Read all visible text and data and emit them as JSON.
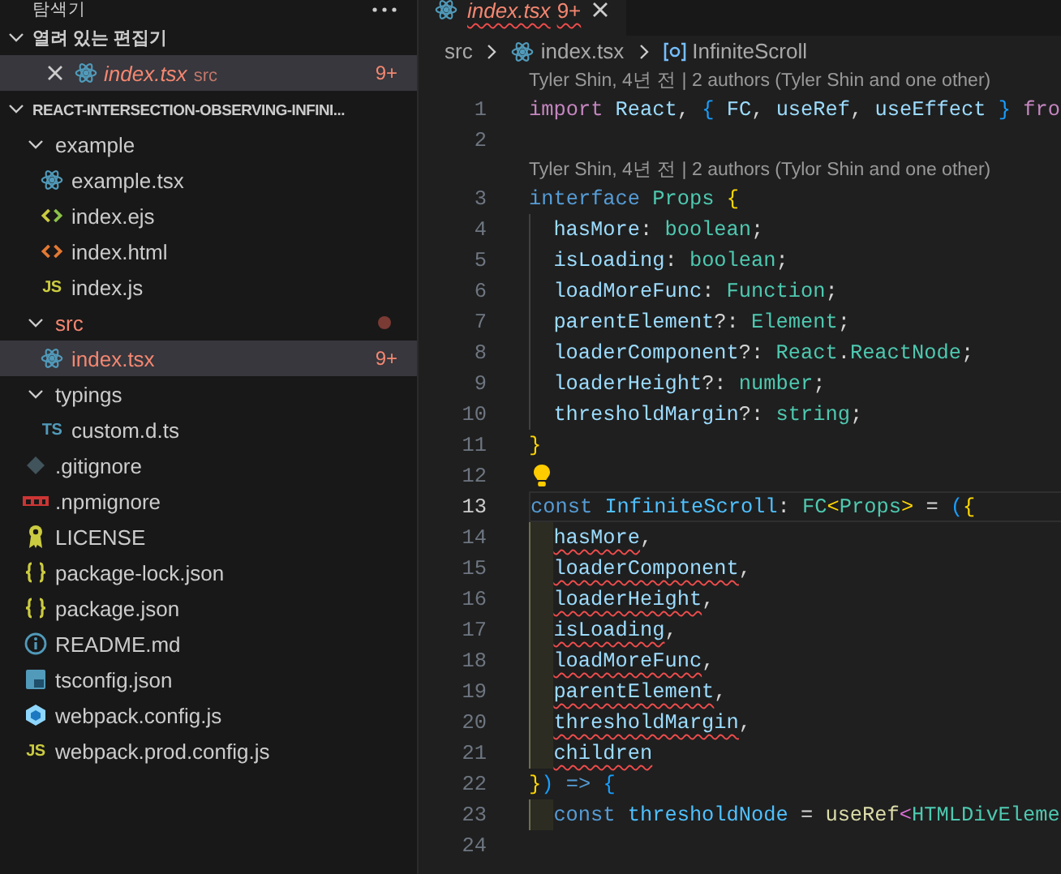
{
  "sidebar": {
    "title": "탐색기",
    "open_editors": {
      "title": "열려 있는 편집기",
      "expanded": true,
      "items": [
        {
          "label": "index.tsx",
          "description": "src",
          "kind": "react",
          "error": true,
          "badge": "9+",
          "preview": true,
          "selected": true
        }
      ]
    },
    "project": {
      "title": "REACT-INTERSECTION-OBSERVING-INFINI...",
      "expanded": true,
      "items": [
        {
          "label": "example",
          "kind": "folder",
          "expanded": true,
          "error": false,
          "selected": false,
          "children": [
            {
              "label": "example.tsx",
              "kind": "react",
              "error": false,
              "selected": false
            },
            {
              "label": "index.ejs",
              "kind": "ejs",
              "error": false,
              "selected": false
            },
            {
              "label": "index.html",
              "kind": "html",
              "error": false,
              "selected": false
            },
            {
              "label": "index.js",
              "kind": "js",
              "icon_text": "JS",
              "error": false,
              "selected": false
            }
          ]
        },
        {
          "label": "src",
          "kind": "folder",
          "expanded": true,
          "error": true,
          "selected": false,
          "children": [
            {
              "label": "index.tsx",
              "kind": "react",
              "error": true,
              "badge": "9+",
              "selected": true
            }
          ]
        },
        {
          "label": "typings",
          "kind": "folder",
          "expanded": true,
          "error": false,
          "selected": false,
          "children": [
            {
              "label": "custom.d.ts",
              "kind": "ts",
              "icon_text": "TS",
              "error": false,
              "selected": false
            }
          ]
        },
        {
          "label": ".gitignore",
          "kind": "git",
          "error": false,
          "selected": false
        },
        {
          "label": ".npmignore",
          "kind": "npm",
          "error": false,
          "selected": false
        },
        {
          "label": "LICENSE",
          "kind": "license",
          "error": false,
          "selected": false
        },
        {
          "label": "package-lock.json",
          "kind": "json",
          "error": false,
          "selected": false
        },
        {
          "label": "package.json",
          "kind": "json",
          "error": false,
          "selected": false
        },
        {
          "label": "README.md",
          "kind": "info",
          "error": false,
          "selected": false
        },
        {
          "label": "tsconfig.json",
          "kind": "tsconfig",
          "error": false,
          "selected": false
        },
        {
          "label": "webpack.config.js",
          "kind": "webpack",
          "error": false,
          "selected": false
        },
        {
          "label": "webpack.prod.config.js",
          "kind": "js",
          "icon_text": "JS",
          "error": false,
          "selected": false
        }
      ]
    }
  },
  "tabs": [
    {
      "label": "index.tsx",
      "kind": "react",
      "badge": "9+",
      "error": true,
      "preview": true,
      "selected": true
    }
  ],
  "breadcrumbs": [
    {
      "label": "src",
      "kind": "folder"
    },
    {
      "label": "index.tsx",
      "kind": "react"
    },
    {
      "label": "InfiniteScroll",
      "kind": "symbol"
    }
  ],
  "editor": {
    "lines": [
      {
        "kind": "codelens",
        "text": "Tyler Shin, 4년 전 | 2 authors (Tyler Shin and one other)"
      },
      {
        "kind": "code",
        "number": "1",
        "tokens": [
          {
            "text": "import ",
            "kind": "ctrl"
          },
          {
            "text": "React",
            "kind": "var"
          },
          {
            "text": ", ",
            "kind": "plain"
          },
          {
            "text": "{ ",
            "kind": "b3"
          },
          {
            "text": "FC",
            "kind": "var"
          },
          {
            "text": ", ",
            "kind": "plain"
          },
          {
            "text": "useRef",
            "kind": "var"
          },
          {
            "text": ", ",
            "kind": "plain"
          },
          {
            "text": "useEffect ",
            "kind": "var"
          },
          {
            "text": "} ",
            "kind": "b3"
          },
          {
            "text": "fro",
            "kind": "ctrl"
          }
        ]
      },
      {
        "kind": "code",
        "number": "2"
      },
      {
        "kind": "codelens",
        "text": "Tyler Shin, 4년 전 | 2 authors (Tylor Shin and one other)"
      },
      {
        "kind": "code",
        "number": "3",
        "tokens": [
          {
            "text": "interface ",
            "kind": "kw"
          },
          {
            "text": "Props ",
            "kind": "type"
          },
          {
            "text": "{",
            "kind": "b1"
          }
        ]
      },
      {
        "kind": "code",
        "number": "4",
        "indent_guide": true,
        "guide_highlighted": false,
        "tokens": [
          {
            "text": "hasMore",
            "kind": "var"
          },
          {
            "text": ": ",
            "kind": "plain"
          },
          {
            "text": "boolean",
            "kind": "type"
          },
          {
            "text": ";",
            "kind": "plain"
          }
        ]
      },
      {
        "kind": "code",
        "number": "5",
        "indent_guide": true,
        "guide_highlighted": false,
        "tokens": [
          {
            "text": "isLoading",
            "kind": "var"
          },
          {
            "text": ": ",
            "kind": "plain"
          },
          {
            "text": "boolean",
            "kind": "type"
          },
          {
            "text": ";",
            "kind": "plain"
          }
        ]
      },
      {
        "kind": "code",
        "number": "6",
        "indent_guide": true,
        "guide_highlighted": false,
        "tokens": [
          {
            "text": "loadMoreFunc",
            "kind": "var"
          },
          {
            "text": ": ",
            "kind": "plain"
          },
          {
            "text": "Function",
            "kind": "type"
          },
          {
            "text": ";",
            "kind": "plain"
          }
        ]
      },
      {
        "kind": "code",
        "number": "7",
        "indent_guide": true,
        "guide_highlighted": false,
        "tokens": [
          {
            "text": "parentElement",
            "kind": "var"
          },
          {
            "text": "?: ",
            "kind": "plain"
          },
          {
            "text": "Element",
            "kind": "type"
          },
          {
            "text": ";",
            "kind": "plain"
          }
        ]
      },
      {
        "kind": "code",
        "number": "8",
        "indent_guide": true,
        "guide_highlighted": false,
        "tokens": [
          {
            "text": "loaderComponent",
            "kind": "var"
          },
          {
            "text": "?: ",
            "kind": "plain"
          },
          {
            "text": "React",
            "kind": "type"
          },
          {
            "text": ".",
            "kind": "plain"
          },
          {
            "text": "ReactNode",
            "kind": "type"
          },
          {
            "text": ";",
            "kind": "plain"
          }
        ]
      },
      {
        "kind": "code",
        "number": "9",
        "indent_guide": true,
        "guide_highlighted": false,
        "tokens": [
          {
            "text": "loaderHeight",
            "kind": "var"
          },
          {
            "text": "?: ",
            "kind": "plain"
          },
          {
            "text": "number",
            "kind": "type"
          },
          {
            "text": ";",
            "kind": "plain"
          }
        ]
      },
      {
        "kind": "code",
        "number": "10",
        "indent_guide": true,
        "guide_highlighted": false,
        "tokens": [
          {
            "text": "thresholdMargin",
            "kind": "var"
          },
          {
            "text": "?: ",
            "kind": "plain"
          },
          {
            "text": "string",
            "kind": "type"
          },
          {
            "text": ";",
            "kind": "plain"
          }
        ]
      },
      {
        "kind": "code",
        "number": "11",
        "tokens": [
          {
            "text": "}",
            "kind": "b1"
          }
        ]
      },
      {
        "kind": "code",
        "number": "12",
        "lightbulb": true
      },
      {
        "kind": "code",
        "number": "13",
        "current": true,
        "tokens": [
          {
            "text": "const ",
            "kind": "kw"
          },
          {
            "text": "InfiniteScroll",
            "kind": "const"
          },
          {
            "text": ": ",
            "kind": "plain"
          },
          {
            "text": "FC",
            "kind": "type"
          },
          {
            "text": "<",
            "kind": "b1"
          },
          {
            "text": "Props",
            "kind": "type"
          },
          {
            "text": ">",
            "kind": "b1"
          },
          {
            "text": " = ",
            "kind": "plain"
          },
          {
            "text": "(",
            "kind": "b3"
          },
          {
            "text": "{",
            "kind": "b1"
          }
        ]
      },
      {
        "kind": "code",
        "number": "14",
        "indent_guide": true,
        "guide_highlighted": true,
        "tokens": [
          {
            "text": "hasMore",
            "kind": "var",
            "error": true
          },
          {
            "text": ",",
            "kind": "plain"
          }
        ]
      },
      {
        "kind": "code",
        "number": "15",
        "indent_guide": true,
        "guide_highlighted": true,
        "tokens": [
          {
            "text": "loaderComponent",
            "kind": "var",
            "error": true
          },
          {
            "text": ",",
            "kind": "plain"
          }
        ]
      },
      {
        "kind": "code",
        "number": "16",
        "indent_guide": true,
        "guide_highlighted": true,
        "tokens": [
          {
            "text": "loaderHeight",
            "kind": "var",
            "error": true
          },
          {
            "text": ",",
            "kind": "plain"
          }
        ]
      },
      {
        "kind": "code",
        "number": "17",
        "indent_guide": true,
        "guide_highlighted": true,
        "tokens": [
          {
            "text": "isLoading",
            "kind": "var",
            "error": true
          },
          {
            "text": ",",
            "kind": "plain"
          }
        ]
      },
      {
        "kind": "code",
        "number": "18",
        "indent_guide": true,
        "guide_highlighted": true,
        "tokens": [
          {
            "text": "loadMoreFunc",
            "kind": "var",
            "error": true
          },
          {
            "text": ",",
            "kind": "plain"
          }
        ]
      },
      {
        "kind": "code",
        "number": "19",
        "indent_guide": true,
        "guide_highlighted": true,
        "tokens": [
          {
            "text": "parentElement",
            "kind": "var",
            "error": true
          },
          {
            "text": ",",
            "kind": "plain"
          }
        ]
      },
      {
        "kind": "code",
        "number": "20",
        "indent_guide": true,
        "guide_highlighted": true,
        "tokens": [
          {
            "text": "thresholdMargin",
            "kind": "var",
            "error": true
          },
          {
            "text": ",",
            "kind": "plain"
          }
        ]
      },
      {
        "kind": "code",
        "number": "21",
        "indent_guide": true,
        "guide_highlighted": true,
        "tokens": [
          {
            "text": "children",
            "kind": "var",
            "error": true
          }
        ]
      },
      {
        "kind": "code",
        "number": "22",
        "tokens": [
          {
            "text": "}",
            "kind": "b1"
          },
          {
            "text": ") ",
            "kind": "b3"
          },
          {
            "text": "=> ",
            "kind": "kw"
          },
          {
            "text": "{",
            "kind": "b3"
          }
        ]
      },
      {
        "kind": "code",
        "number": "23",
        "indent_guide": true,
        "guide_highlighted": true,
        "tokens": [
          {
            "text": "const ",
            "kind": "kw"
          },
          {
            "text": "thresholdNode",
            "kind": "const"
          },
          {
            "text": " = ",
            "kind": "plain"
          },
          {
            "text": "useRef",
            "kind": "fn"
          },
          {
            "text": "<",
            "kind": "b2"
          },
          {
            "text": "HTMLDivEleme",
            "kind": "type"
          }
        ]
      },
      {
        "kind": "code",
        "number": "24"
      }
    ]
  }
}
